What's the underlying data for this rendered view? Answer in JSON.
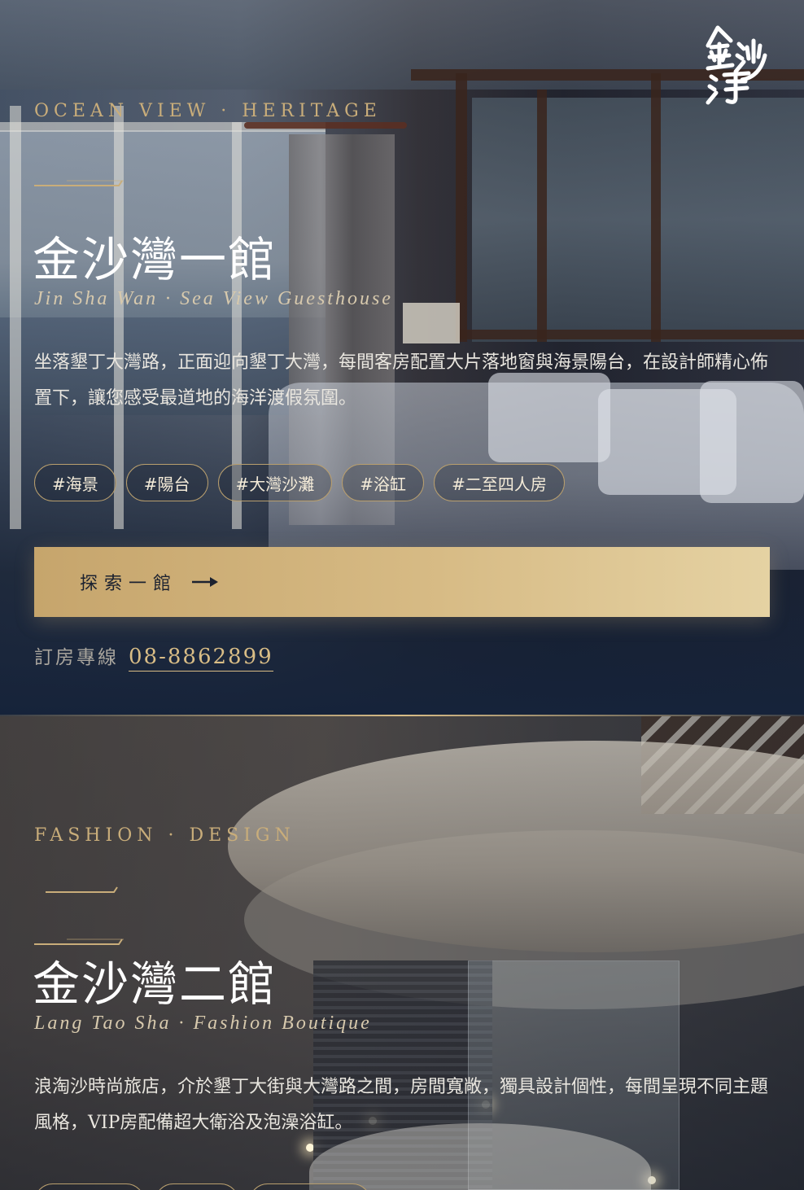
{
  "brand": {
    "logo_text": "金沙灣",
    "accent_color": "#c9ad7a"
  },
  "sections": [
    {
      "eyebrow": "OCEAN VIEW · HERITAGE",
      "title": "金沙灣一館",
      "subtitle": "Jin Sha Wan · Sea View Guesthouse",
      "description": "坐落墾丁大灣路，正面迎向墾丁大灣，每間客房配置大片落地窗與海景陽台，在設計師精心佈置下，讓您感受最道地的海洋渡假氛圍。",
      "tags": [
        "#海景",
        "#陽台",
        "#大灣沙灘",
        "#浴缸",
        "#二至四人房"
      ],
      "cta_label": "探索一館",
      "hotline_label": "訂房專線",
      "hotline_number": "08-8862899"
    },
    {
      "eyebrow": "FASHION · DESIGN",
      "title": "金沙灣二館",
      "subtitle": "Lang Tao Sha · Fashion Boutique",
      "description": "浪淘沙時尚旅店，介於墾丁大街與大灣路之間，房間寬敞，獨具設計個性，每間呈現不同主題風格，VIP房配備超大衛浴及泡澡浴缸。"
    }
  ]
}
